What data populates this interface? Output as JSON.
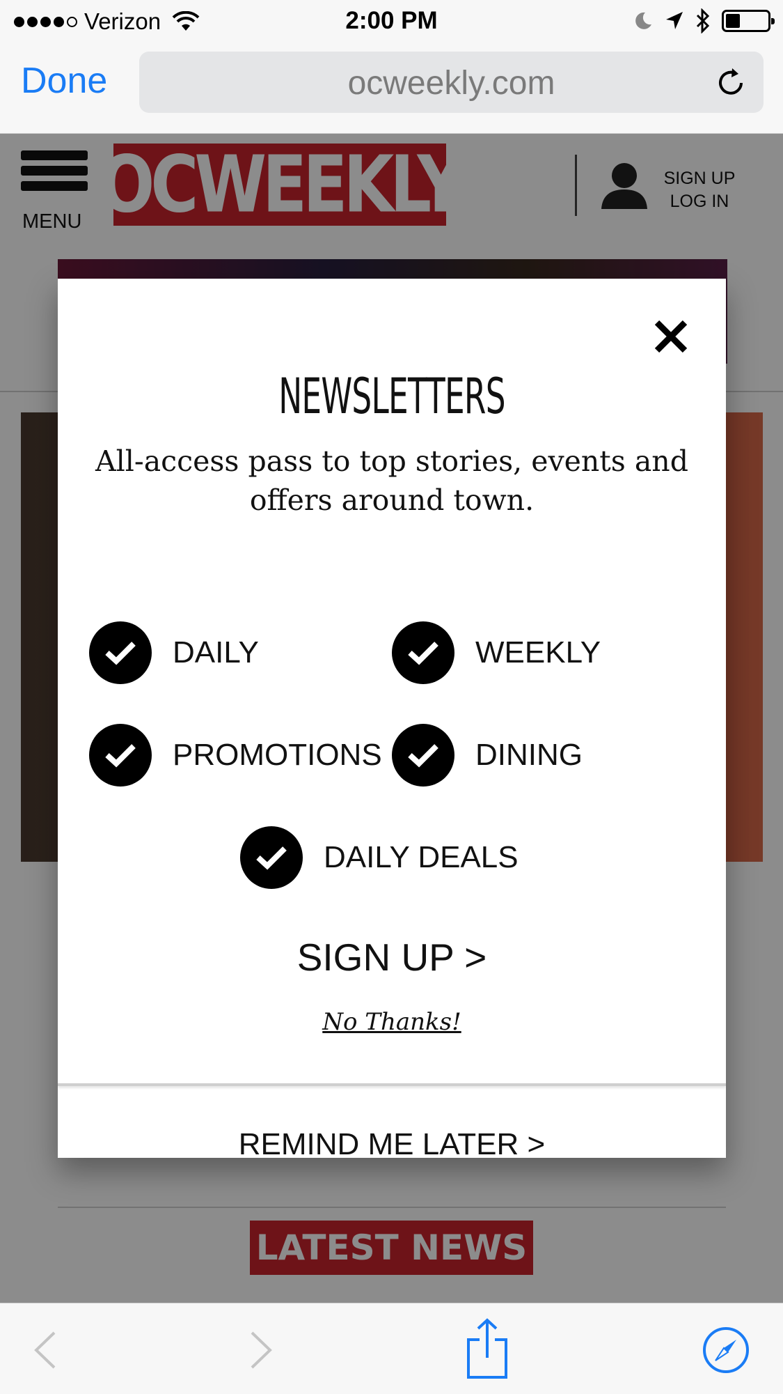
{
  "status_bar": {
    "carrier": "Verizon",
    "time": "2:00 PM",
    "signal_bars": 4,
    "battery_level": 0.35
  },
  "browser": {
    "done_label": "Done",
    "url": "ocweekly.com",
    "reload_icon": "reload-icon"
  },
  "site_header": {
    "menu_label": "MENU",
    "logo_text": "OCWEEKLY",
    "sign_up_label": "SIGN UP",
    "log_in_label": "LOG IN"
  },
  "page": {
    "latest_news_label": "LATEST NEWS"
  },
  "modal": {
    "title": "NEWSLETTERS",
    "subtitle": "All-access pass to top stories, events and offers around town.",
    "options": [
      {
        "label": "DAILY",
        "checked": true
      },
      {
        "label": "WEEKLY",
        "checked": true
      },
      {
        "label": "PROMOTIONS",
        "checked": true
      },
      {
        "label": "DINING",
        "checked": true
      },
      {
        "label": "DAILY DEALS",
        "checked": true
      }
    ],
    "signup_label": "SIGN UP >",
    "no_thanks_label": "No Thanks!",
    "remind_label": "REMIND ME LATER >"
  },
  "toolbar": {
    "icons": [
      "back-icon",
      "forward-icon",
      "share-icon",
      "compass-icon"
    ]
  },
  "colors": {
    "ios_blue": "#1a7cf5",
    "brand_red": "#c8232c"
  }
}
